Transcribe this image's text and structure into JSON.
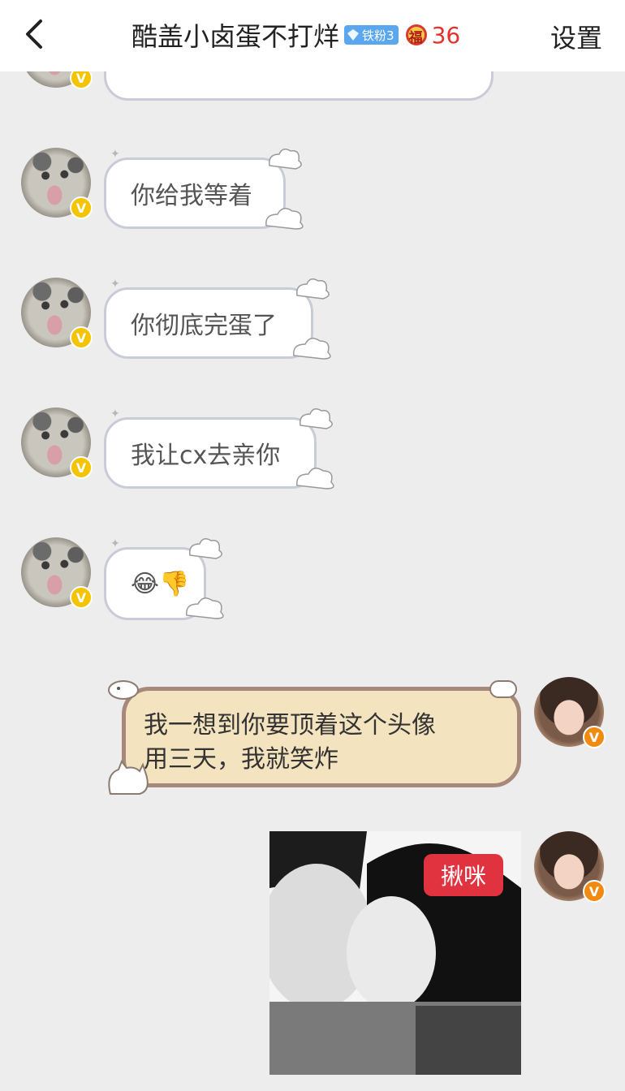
{
  "header": {
    "title": "酷盖小卤蛋不打烊",
    "fan_badge": "铁粉3",
    "fu_icon": "福",
    "fu_count": "36",
    "settings_label": "设置"
  },
  "messages": [
    {
      "side": "left",
      "text": "你给我等着"
    },
    {
      "side": "left",
      "text": "你彻底完蛋了"
    },
    {
      "side": "left",
      "text": "我让cx去亲你"
    },
    {
      "side": "left",
      "text": "😂👎"
    },
    {
      "side": "right",
      "line1": "我一想到你要顶着这个头像",
      "line2": "用三天，我就笑炸"
    },
    {
      "side": "right",
      "sticker_text": "揪咪"
    }
  ],
  "badges": {
    "verified": "V"
  },
  "colors": {
    "background": "#ededed",
    "fan_badge": "#5aa7ef",
    "fu_count": "#e6312c",
    "bubble_border_left": "#c8ccd6",
    "bubble_right_fill": "#f4e3bf",
    "bubble_right_border": "#a6897a"
  }
}
